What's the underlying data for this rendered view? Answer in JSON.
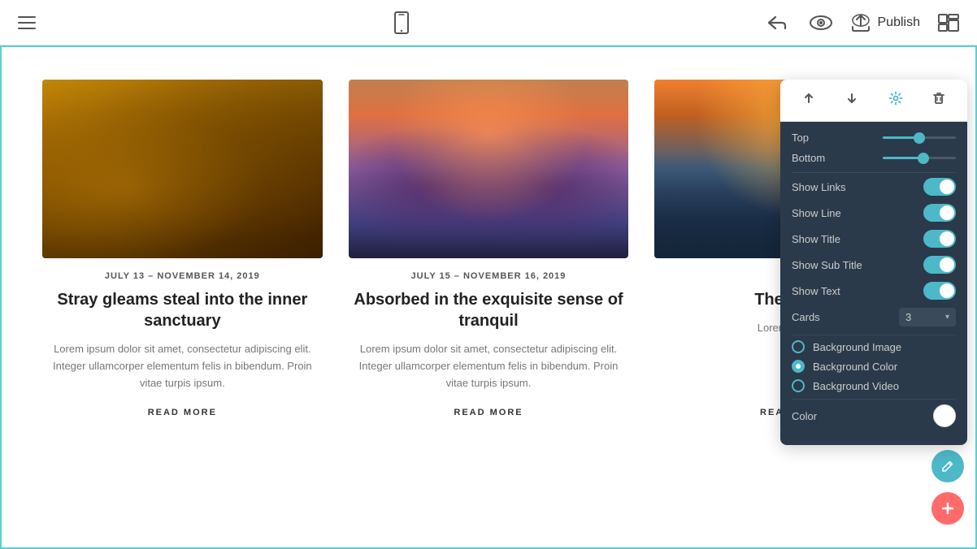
{
  "navbar": {
    "publish_label": "Publish"
  },
  "cards": [
    {
      "date": "JULY 13 – NOVEMBER 14, 2019",
      "title": "Stray gleams steal into the inner sanctuary",
      "text": "Lorem ipsum dolor sit amet, consectetur adipiscing elit. Integer ullamcorper elementum felis in bibendum. Proin vitae turpis ipsum.",
      "link": "READ MORE"
    },
    {
      "date": "JULY 15 – NOVEMBER 16, 2019",
      "title": "Absorbed in the exquisite sense of tranquil",
      "text": "Lorem ipsum dolor sit amet, consectetur adipiscing elit. Integer ullamcorper elementum felis in bibendum. Proin vitae turpis ipsum.",
      "link": "READ MORE"
    },
    {
      "date": "JU...",
      "title": "The m...ne",
      "text": "Lorem adipisc...",
      "link": "READ MORE"
    }
  ],
  "toolbar": {
    "top_label": "Top",
    "bottom_label": "Bottom",
    "show_links_label": "Show Links",
    "show_line_label": "Show Line",
    "show_title_label": "Show Title",
    "show_subtitle_label": "Show Sub Title",
    "show_text_label": "Show Text",
    "cards_label": "Cards",
    "cards_value": "3",
    "bg_image_label": "Background Image",
    "bg_color_label": "Background Color",
    "bg_video_label": "Background Video",
    "color_label": "Color",
    "top_slider_pct": 50,
    "bottom_slider_pct": 55
  }
}
